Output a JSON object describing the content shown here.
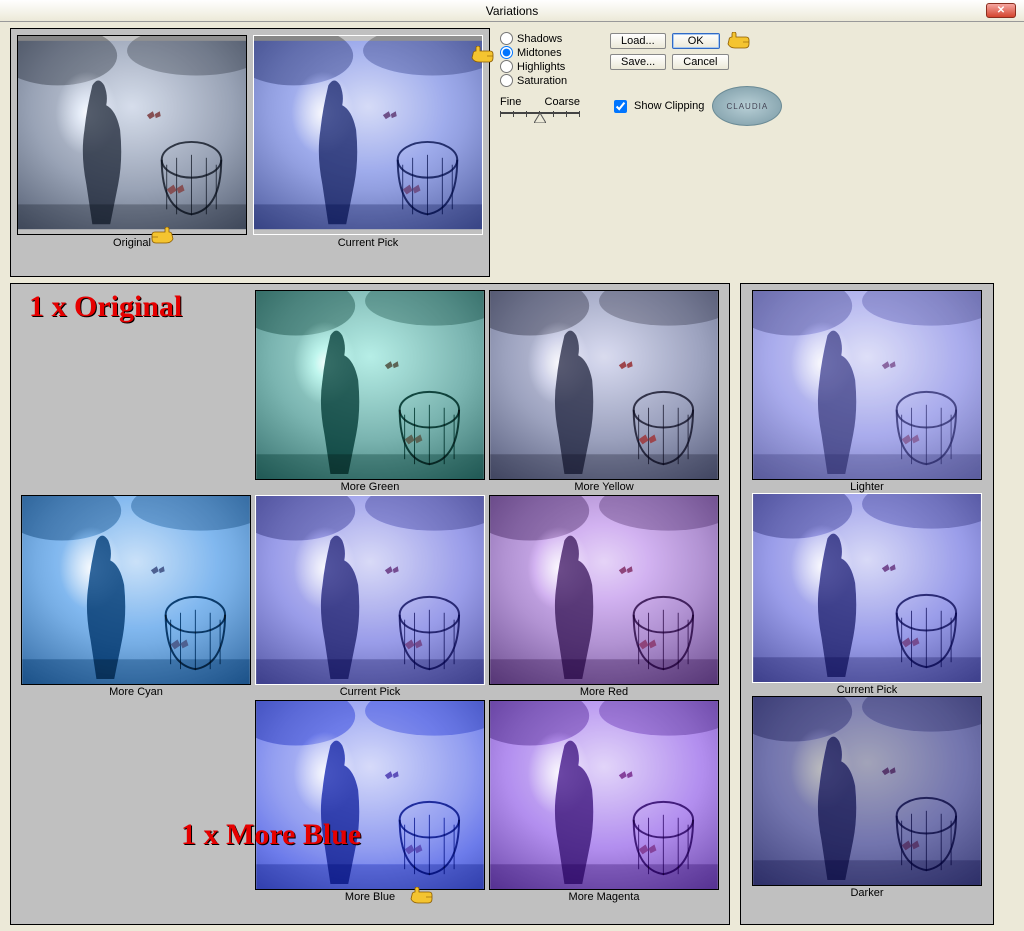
{
  "window": {
    "title": "Variations"
  },
  "topPreview": {
    "original": "Original",
    "currentPick": "Current Pick"
  },
  "radios": {
    "shadows": "Shadows",
    "midtones": "Midtones",
    "highlights": "Highlights",
    "saturation": "Saturation"
  },
  "slider": {
    "fine": "Fine",
    "coarse": "Coarse"
  },
  "buttons": {
    "load": "Load...",
    "save": "Save...",
    "ok": "OK",
    "cancel": "Cancel"
  },
  "showClipping": "Show Clipping",
  "badge": "CLAUDIA",
  "colorGrid": {
    "moreGreen": "More Green",
    "moreYellow": "More Yellow",
    "moreCyan": "More Cyan",
    "currentPick": "Current Pick",
    "moreRed": "More Red",
    "moreBlue": "More Blue",
    "moreMagenta": "More Magenta"
  },
  "lightCol": {
    "lighter": "Lighter",
    "currentPick": "Current Pick",
    "darker": "Darker"
  },
  "annotations": {
    "oneOriginal": "1 x Original",
    "oneMoreBlue": "1 x More Blue"
  }
}
